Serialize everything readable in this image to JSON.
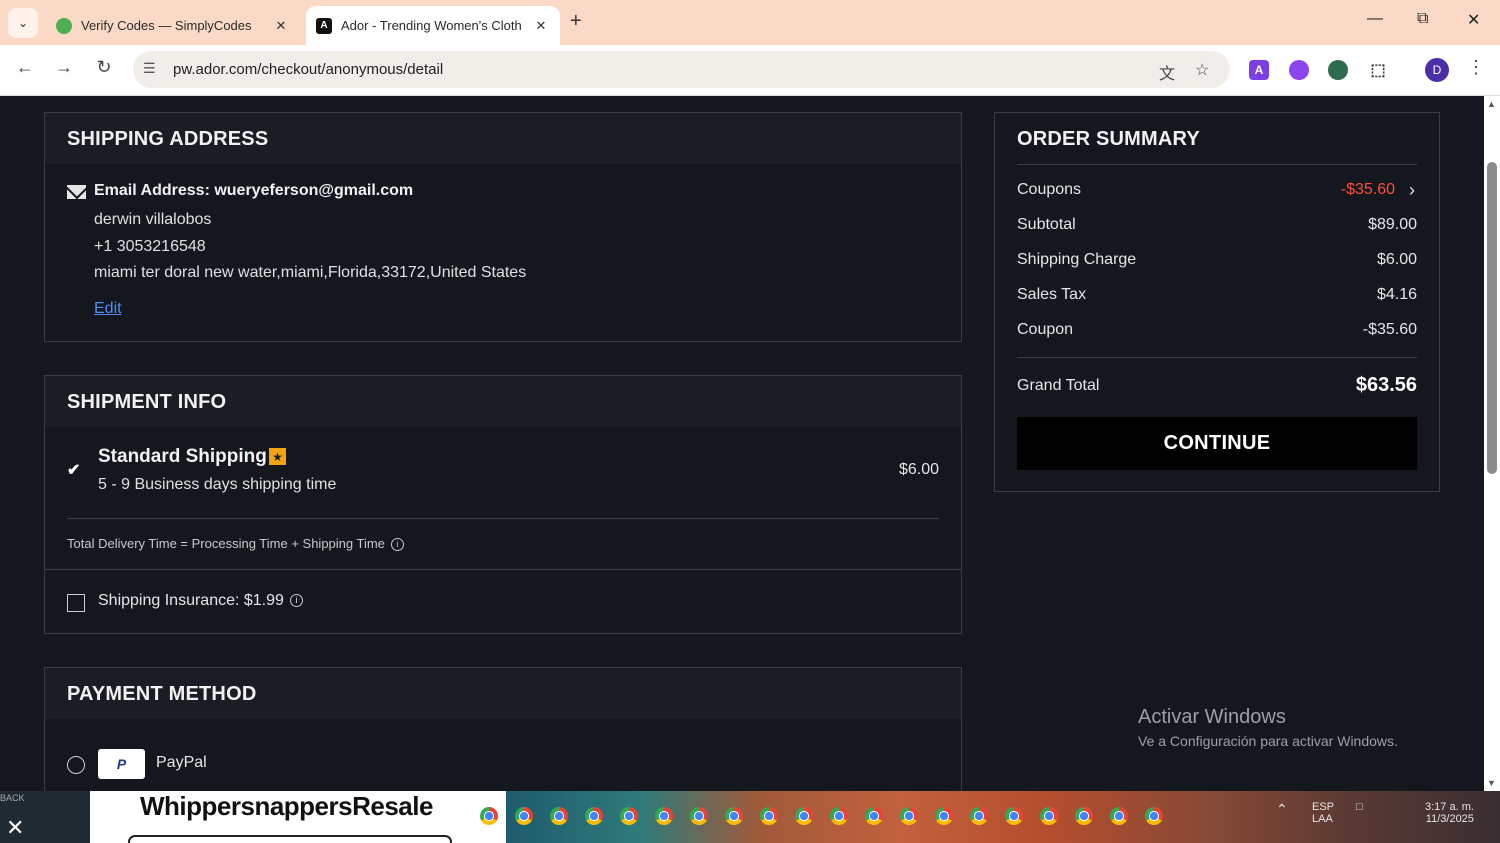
{
  "browser": {
    "tabs": [
      {
        "title": "Verify Codes — SimplyCodes",
        "active": false,
        "icon": "simplycodes-icon"
      },
      {
        "title": "Ador - Trending Women's Cloth",
        "active": true,
        "icon": "ador-icon"
      }
    ],
    "favicon_glyphs": {
      "ador": "A"
    },
    "url": "pw.ador.com/checkout/anonymous/detail",
    "tab_close_glyph": "✕",
    "new_tab_glyph": "+",
    "profile_initial": "D",
    "extension_glyphs": {
      "ador": "A"
    }
  },
  "shipping_address": {
    "title": "SHIPPING ADDRESS",
    "email_line": "Email Address: wueryeferson@gmail.com",
    "name": "derwin villalobos",
    "phone": "+1 3053216548",
    "address": "miami ter doral new water,miami,Florida,33172,United States",
    "edit_label": "Edit"
  },
  "shipment_info": {
    "title": "SHIPMENT INFO",
    "method_name": "Standard Shipping",
    "method_time": "5 - 9 Business days shipping time",
    "method_price": "$6.00",
    "delivery_note": "Total Delivery Time = Processing Time + Shipping Time",
    "info_glyph": "i",
    "checked": true
  },
  "insurance": {
    "label": "Shipping Insurance: $1.99",
    "checked": false
  },
  "payment": {
    "title": "PAYMENT METHOD",
    "option_label": "PayPal",
    "logo_text": "P"
  },
  "order_summary": {
    "title": "ORDER SUMMARY",
    "rows": [
      {
        "label": "Coupons",
        "value": "-$35.60"
      },
      {
        "label": "Subtotal",
        "value": "$89.00"
      },
      {
        "label": "Shipping Charge",
        "value": "$6.00"
      },
      {
        "label": "Sales Tax",
        "value": "$4.16"
      },
      {
        "label": "Coupon",
        "value": "-$35.60"
      }
    ],
    "grand_total_label": "Grand Total",
    "grand_total_value": "$63.56",
    "continue_label": "CONTINUE"
  },
  "windows_watermark": {
    "line1": "Activar Windows",
    "line2": "Ve a Configuración para activar Windows."
  },
  "taskbar": {
    "ad_text": "WhippersnappersResale",
    "left_text": "BACK",
    "tray_lang": "ESP LAA",
    "tray_time": "3:17 a. m.",
    "tray_date": "11/3/2025"
  },
  "colors": {
    "page_bg": "#15171f",
    "coupon_red": "#ff4d3a",
    "link_blue": "#4f8df5",
    "badge_orange": "#f2a413",
    "tab_strip": "#fad9c6"
  }
}
